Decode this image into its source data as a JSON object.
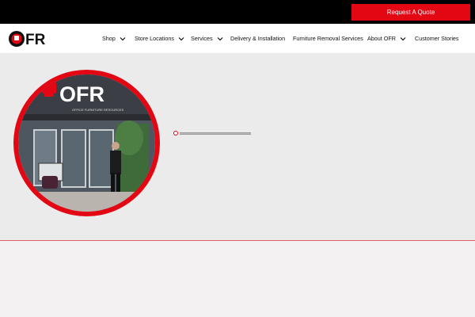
{
  "topbar": {
    "request_quote_label": "Request A Quote"
  },
  "header": {
    "logo_text": "OFR",
    "nav": [
      {
        "label": "Shop",
        "has_dropdown": true
      },
      {
        "label": "Store Locations",
        "has_dropdown": true
      },
      {
        "label": "Services",
        "has_dropdown": true
      },
      {
        "label": "Delivery & Installation",
        "has_dropdown": false
      },
      {
        "label": "Furniture Removal Services",
        "has_dropdown": false
      },
      {
        "label": "About OFR",
        "has_dropdown": true
      },
      {
        "label": "Customer Stories",
        "has_dropdown": false
      }
    ]
  },
  "hero": {
    "storefront_sign": "OFR",
    "storefront_subtitle": "OFFICE FURNITURE RESOURCES"
  },
  "colors": {
    "brand_red": "#e30613",
    "topbar": "#000000",
    "hero_bg": "#ebebeb"
  }
}
